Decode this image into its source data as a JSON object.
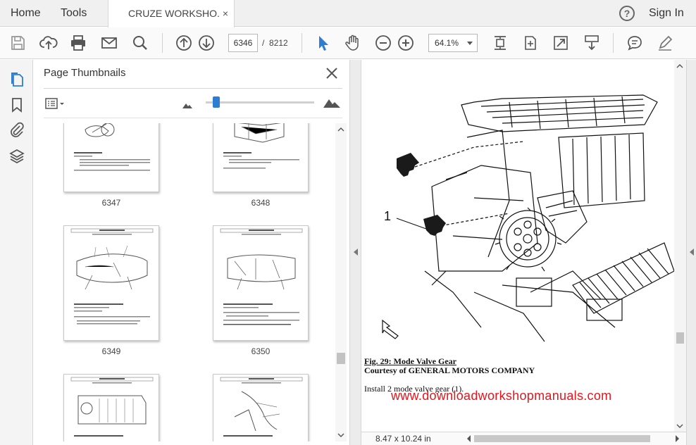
{
  "menu": {
    "home_label": "Home",
    "tools_label": "Tools",
    "tab_title": "CRUZE WORKSHO...",
    "tab_close": "×",
    "help_glyph": "?",
    "sign_in_label": "Sign In"
  },
  "toolbar": {
    "current_page": "6346",
    "page_separator": "/",
    "total_pages": "8212",
    "zoom_value": "64.1%",
    "accent_color": "#2d7dd2",
    "icons": [
      "save-icon",
      "upload-icon",
      "print-icon",
      "email-icon",
      "search-icon",
      "page-up-icon",
      "page-down-icon",
      "select-arrow-icon",
      "hand-icon",
      "zoom-out-icon",
      "zoom-in-icon",
      "fit-page-icon",
      "rotate-icon",
      "fullscreen-icon",
      "scroll-mode-icon",
      "comment-icon",
      "sign-icon"
    ]
  },
  "rail": {
    "icons": [
      "page-thumbnails-icon",
      "bookmarks-icon",
      "attachments-icon",
      "layers-icon"
    ]
  },
  "thumbnails_panel": {
    "title": "Page Thumbnails",
    "pages": [
      {
        "label": "6347"
      },
      {
        "label": "6348"
      },
      {
        "label": "6349"
      },
      {
        "label": "6350"
      }
    ]
  },
  "document": {
    "callout_number": "1",
    "figure_caption": "Fig. 29: Mode Valve Gear",
    "figure_credit": "Courtesy of GENERAL MOTORS COMPANY",
    "step_text": "Install 2 mode valve gear (1).",
    "watermark": "www.downloadworkshopmanuals.com",
    "watermark_color": "#e8141c"
  },
  "status": {
    "page_size": "8.47 x 10.24 in"
  }
}
